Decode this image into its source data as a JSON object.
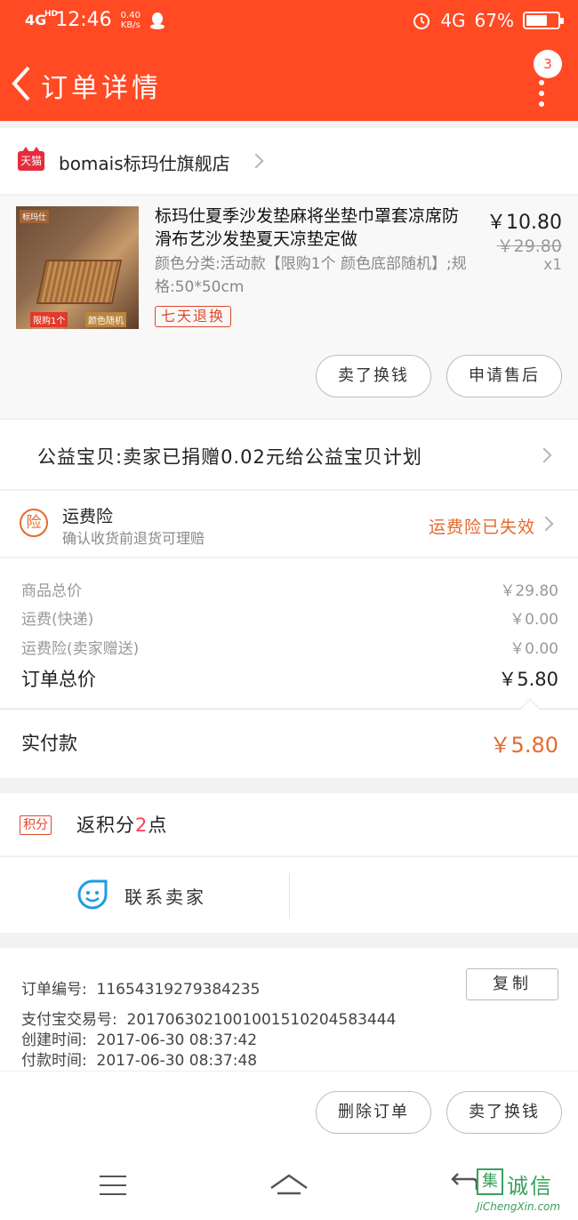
{
  "status": {
    "signal": "4G",
    "signal_hd": "HD",
    "time": "12:46",
    "net_speed_value": "0.40",
    "net_speed_unit": "KB/s",
    "network": "4G",
    "battery": "67%",
    "battery_level": 0.67
  },
  "nav": {
    "title": "订单详情",
    "badge": "3"
  },
  "shop": {
    "badge": "天猫",
    "name": "bomais标玛仕旗舰店"
  },
  "product": {
    "thumb_brand": "标玛仕",
    "thumb_tag_left": "限购1个",
    "thumb_tag_right": "颜色随机",
    "title": "标玛仕夏季沙发垫麻将坐垫巾罩套凉席防滑布艺沙发垫夏天凉垫定做",
    "spec": "颜色分类:活动款【限购1个 颜色底部随机】;规格:50*50cm",
    "price": "￥10.80",
    "original_price": "￥29.80",
    "quantity": "x1",
    "return_tag": "七天退换",
    "btn_resell": "卖了换钱",
    "btn_aftersale": "申请售后"
  },
  "charity": {
    "text": "公益宝贝:卖家已捐赠0.02元给公益宝贝计划"
  },
  "insurance": {
    "icon": "险",
    "title": "运费险",
    "subtitle": "确认收货前退货可理赔",
    "status": "运费险已失效"
  },
  "summary": {
    "rows": [
      {
        "label": "商品总价",
        "value": "￥29.80"
      },
      {
        "label": "运费(快递)",
        "value": "￥0.00"
      },
      {
        "label": "运费险(卖家赠送)",
        "value": "￥0.00"
      }
    ],
    "total_label": "订单总价",
    "total_value": "￥5.80",
    "paid_label": "实付款",
    "paid_value": "￥5.80"
  },
  "points": {
    "badge": "积分",
    "text_prefix": "返积分",
    "count": "2",
    "text_suffix": "点"
  },
  "contact": {
    "label": "联系卖家"
  },
  "order_info": {
    "order_no_label": "订单编号:",
    "order_no": "11654319279384235",
    "copy": "复制",
    "alipay_label": "支付宝交易号:",
    "alipay_no": "2017063021001001510204583444",
    "created_label": "创建时间:",
    "created": "2017-06-30 08:37:42",
    "paid_label": "付款时间:",
    "paid": "2017-06-30 08:37:48"
  },
  "actions": {
    "delete": "删除订单",
    "resell": "卖了换钱"
  },
  "watermark": {
    "logo": "集",
    "name": "诚信",
    "url": "JiChengXin.com"
  },
  "colors": {
    "brand": "#ff4a24",
    "accent_orange": "#e46a2c",
    "tmall_red": "#e62b3b"
  }
}
